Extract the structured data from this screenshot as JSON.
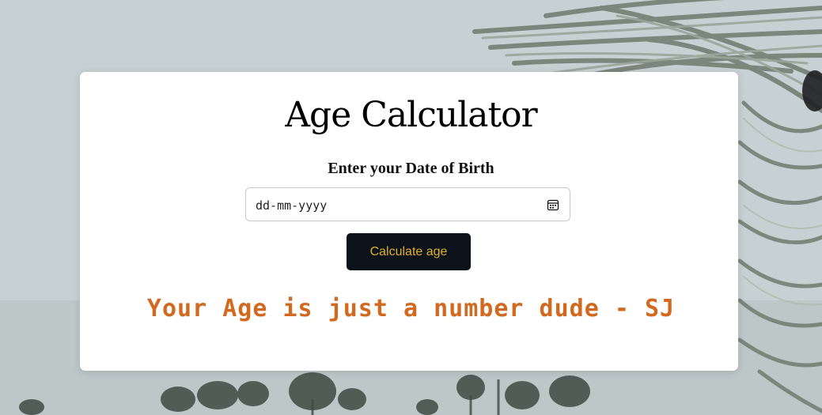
{
  "page": {
    "title": "Age Calculator",
    "input_label": "Enter your Date of Birth",
    "date_input": {
      "placeholder": "dd-mm-yyyy",
      "icon": "calendar-icon"
    },
    "button_label": "Calculate age",
    "result_text": "Your Age is just a number dude - SJ"
  },
  "colors": {
    "card_background": "#ffffff",
    "button_background": "#0b1219",
    "button_text": "#e0b12a",
    "result_text": "#d2691e",
    "background_sky": "#c9d3d6"
  }
}
